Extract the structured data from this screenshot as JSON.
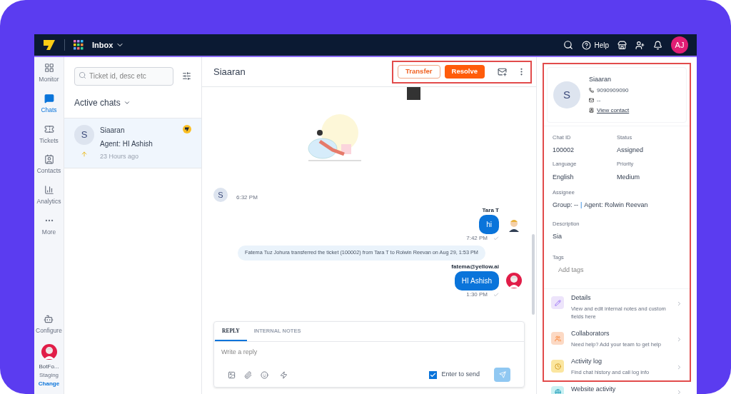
{
  "topbar": {
    "app_label": "Inbox",
    "help": "Help",
    "avatar": "AJ"
  },
  "nav": {
    "items": [
      {
        "label": "Monitor",
        "selected": false
      },
      {
        "label": "Chats",
        "selected": true
      },
      {
        "label": "Tickets",
        "selected": false
      },
      {
        "label": "Contacts",
        "selected": false
      },
      {
        "label": "Analytics",
        "selected": false
      },
      {
        "label": "More",
        "selected": false
      }
    ],
    "configure": "Configure",
    "bot": {
      "name": "BotFo...",
      "env": "Staging",
      "link": "Change"
    }
  },
  "chat_list": {
    "search": {
      "placeholder": "Ticket id, desc etc"
    },
    "heading": "Active chats",
    "chats": [
      {
        "initial": "S",
        "name": "Siaaran",
        "agent": "Agent: HI Ashish",
        "time": "23 Hours ago",
        "selected": true
      }
    ]
  },
  "conversation": {
    "title": "Siaaran",
    "buttons": [
      {
        "label": "Transfer",
        "kind": "outline"
      },
      {
        "label": "Resolve",
        "kind": "filled"
      }
    ],
    "messages": [
      {
        "kind": "illustration"
      },
      {
        "kind": "incoming",
        "initial": "S",
        "time": "6:32 PM"
      },
      {
        "kind": "outgoing",
        "sender": "Tara T",
        "text": "hi",
        "time": "7:42 PM"
      },
      {
        "kind": "event",
        "text": "Fatema Tuz Johura transferred the ticket (100002) from Tara T to Rolwin Reevan on Aug 29, 1:53 PM"
      },
      {
        "kind": "outgoing",
        "sender": "fatema@yellow.ai",
        "text": "HI Ashish",
        "time": "1:30 PM"
      }
    ],
    "composer": {
      "tabs": [
        {
          "label": "REPLY",
          "selected": true
        },
        {
          "label": "INTERNAL NOTES",
          "selected": false
        }
      ],
      "placeholder": "Write a reply",
      "enter_to_send": {
        "label": "Enter to send",
        "checked": true
      }
    }
  },
  "contact": {
    "initial": "S",
    "name": "Siaaran",
    "phone": "9090909090",
    "email": "--",
    "link": "View contact",
    "fields": [
      {
        "label": "Chat ID",
        "value": "100002"
      },
      {
        "label": "Status",
        "value": "Assigned"
      },
      {
        "label": "Language",
        "value": "English"
      },
      {
        "label": "Priority",
        "value": "Medium"
      }
    ],
    "assignee": {
      "label": "Assignee",
      "group": "Group: --",
      "separator": "|",
      "agent": "Agent: Rolwin Reevan"
    },
    "description": {
      "label": "Description",
      "value": "Sia"
    },
    "tags": {
      "label": "Tags",
      "placeholder": "Add tags"
    },
    "sections": [
      {
        "title": "Details",
        "subtitle": "View and edit internal notes and custom fields here",
        "color": "#ede4fb"
      },
      {
        "title": "Collaborators",
        "subtitle": "Need help? Add your team to get help",
        "color": "#fcd9c4"
      },
      {
        "title": "Activity log",
        "subtitle": "Find chat history and call log info",
        "color": "#fbe6a0"
      },
      {
        "title": "Website activity",
        "color": "#c9f1f3"
      }
    ]
  }
}
